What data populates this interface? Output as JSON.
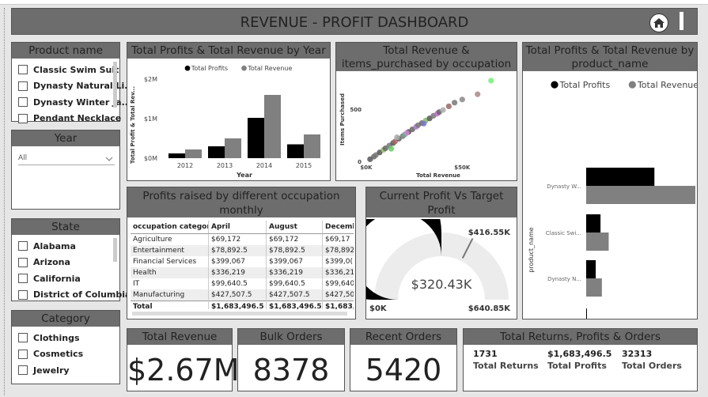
{
  "dashboard_title": "REVENUE - PROFIT DASHBOARD",
  "icons": {
    "home": "home-icon",
    "menu": "panel-toggle-icon"
  },
  "slicers": {
    "product": {
      "title": "Product name",
      "items": [
        "Classic Swim Suit",
        "Dynasty Natural Li...",
        "Dynasty Winter Ja...",
        "Pendant Necklace"
      ]
    },
    "year": {
      "title": "Year",
      "selected": "All"
    },
    "state": {
      "title": "State",
      "items": [
        "Alabama",
        "Arizona",
        "California",
        "District of Columbia"
      ]
    },
    "category": {
      "title": "Category",
      "items": [
        "Clothings",
        "Cosmetics",
        "Jewelry"
      ]
    }
  },
  "year_chart": {
    "title": "Total Profits & Total Revenue by Year"
  },
  "scatter": {
    "title": "Total Revenue & items_purchased by occupation"
  },
  "product_chart": {
    "title": "Total Profits & Total Revenue by product_name"
  },
  "matrix": {
    "title": "Profits raised by different occupation monthly",
    "columns": [
      "occupation category",
      "April",
      "August",
      "December"
    ],
    "rows": [
      [
        "Agriculture",
        "$69,172",
        "$69,172",
        "$69,17"
      ],
      [
        "Entertainment",
        "$78,892.5",
        "$78,892.5",
        "$78,892"
      ],
      [
        "Financial Services",
        "$399,067",
        "$399,067",
        "$399,0("
      ],
      [
        "Health",
        "$336,219",
        "$336,219",
        "$336,219"
      ],
      [
        "IT",
        "$99,640.5",
        "$99,640.5",
        "$99,640"
      ],
      [
        "Manufacturing",
        "$427,507.5",
        "$427,507.5",
        "$427,507"
      ]
    ],
    "total": [
      "Total",
      "$1,683,496.5",
      "$1,683,496.5",
      "$1,683,496"
    ]
  },
  "gauge": {
    "title": "Current Profit Vs Target Profit",
    "value_label": "$320.43K",
    "min_label": "$0K",
    "max_label": "$640.85K",
    "target_label": "$416.55K",
    "value": 320.43,
    "min": 0,
    "max": 640.85,
    "target": 416.55
  },
  "cards": {
    "revenue": {
      "title": "Total Revenue",
      "value": "$2.67M"
    },
    "bulk": {
      "title": "Bulk Orders",
      "value": "8378"
    },
    "recent": {
      "title": "Recent Orders",
      "value": "5420"
    }
  },
  "returns_card": {
    "title": "Total Returns, Profits & Orders",
    "items": [
      {
        "value": "1731",
        "label": "Total Returns"
      },
      {
        "value": "$1,683,496.5",
        "label": "Total Profits"
      },
      {
        "value": "32313",
        "label": "Total Orders"
      }
    ]
  },
  "colors": {
    "header": "#6d6d6d",
    "profit": "#000000",
    "revenue": "#808080"
  },
  "chart_data": [
    {
      "type": "bar",
      "title": "Total Profits & Total Revenue by Year",
      "categories": [
        "2012",
        "2013",
        "2014",
        "2015"
      ],
      "series": [
        {
          "name": "Total Profits",
          "values": [
            0.12,
            0.3,
            1.02,
            0.35
          ]
        },
        {
          "name": "Total Revenue",
          "values": [
            0.22,
            0.5,
            1.6,
            0.6
          ]
        }
      ],
      "xlabel": "Year",
      "ylabel": "Total Profit & Total Rev...",
      "yticks": [
        "$0M",
        "$1M",
        "$2M"
      ],
      "ylim": [
        0,
        2
      ],
      "legend": "top-center"
    },
    {
      "type": "scatter",
      "title": "Total Revenue & items_purchased by occupation",
      "xlabel": "Total Revenue",
      "ylabel": "Items Purchased",
      "xticks": [
        "$0K",
        "$50K"
      ],
      "yticks": [
        "0",
        "500"
      ],
      "xlim": [
        0,
        75
      ],
      "ylim": [
        0,
        800
      ],
      "points": [
        [
          2,
          20,
          "#555"
        ],
        [
          4,
          45,
          "#666"
        ],
        [
          5,
          60,
          "#777"
        ],
        [
          7,
          85,
          "#555"
        ],
        [
          9,
          110,
          "#8b6"
        ],
        [
          10,
          125,
          "#666"
        ],
        [
          12,
          150,
          "#777"
        ],
        [
          14,
          175,
          "#555"
        ],
        [
          15,
          190,
          "#a66"
        ],
        [
          17,
          215,
          "#666"
        ],
        [
          19,
          240,
          "#777"
        ],
        [
          20,
          255,
          "#6a8"
        ],
        [
          22,
          280,
          "#555"
        ],
        [
          24,
          305,
          "#666"
        ],
        [
          26,
          330,
          "#a7c"
        ],
        [
          27,
          345,
          "#777"
        ],
        [
          29,
          365,
          "#666"
        ],
        [
          31,
          390,
          "#8b6"
        ],
        [
          33,
          410,
          "#555"
        ],
        [
          35,
          435,
          "#777"
        ],
        [
          37,
          455,
          "#c6c"
        ],
        [
          38,
          470,
          "#666"
        ],
        [
          40,
          490,
          "#aaa"
        ],
        [
          43,
          525,
          "#966"
        ],
        [
          46,
          560,
          "#777"
        ],
        [
          50,
          590,
          "#888"
        ],
        [
          58,
          640,
          "#a88"
        ],
        [
          13,
          120,
          "#6c6"
        ],
        [
          21,
          270,
          "#c8c"
        ],
        [
          30,
          360,
          "#77c"
        ],
        [
          16,
          230,
          "#aaa"
        ],
        [
          65,
          770,
          "#7e7"
        ]
      ]
    },
    {
      "type": "bar",
      "orientation": "horizontal",
      "title": "Total Profits & Total Revenue by product_name",
      "categories": [
        "Dynasty W...",
        "Classic Swi...",
        "Dynasty N...",
        "Pendant N..."
      ],
      "series": [
        {
          "name": "Total Profits",
          "values": [
            1.0,
            0.21,
            0.14,
            0.01
          ]
        },
        {
          "name": "Total Revenue",
          "values": [
            1.6,
            0.33,
            0.23,
            0.01
          ]
        }
      ],
      "ylabel": "product_name",
      "legend": "top-center"
    }
  ]
}
